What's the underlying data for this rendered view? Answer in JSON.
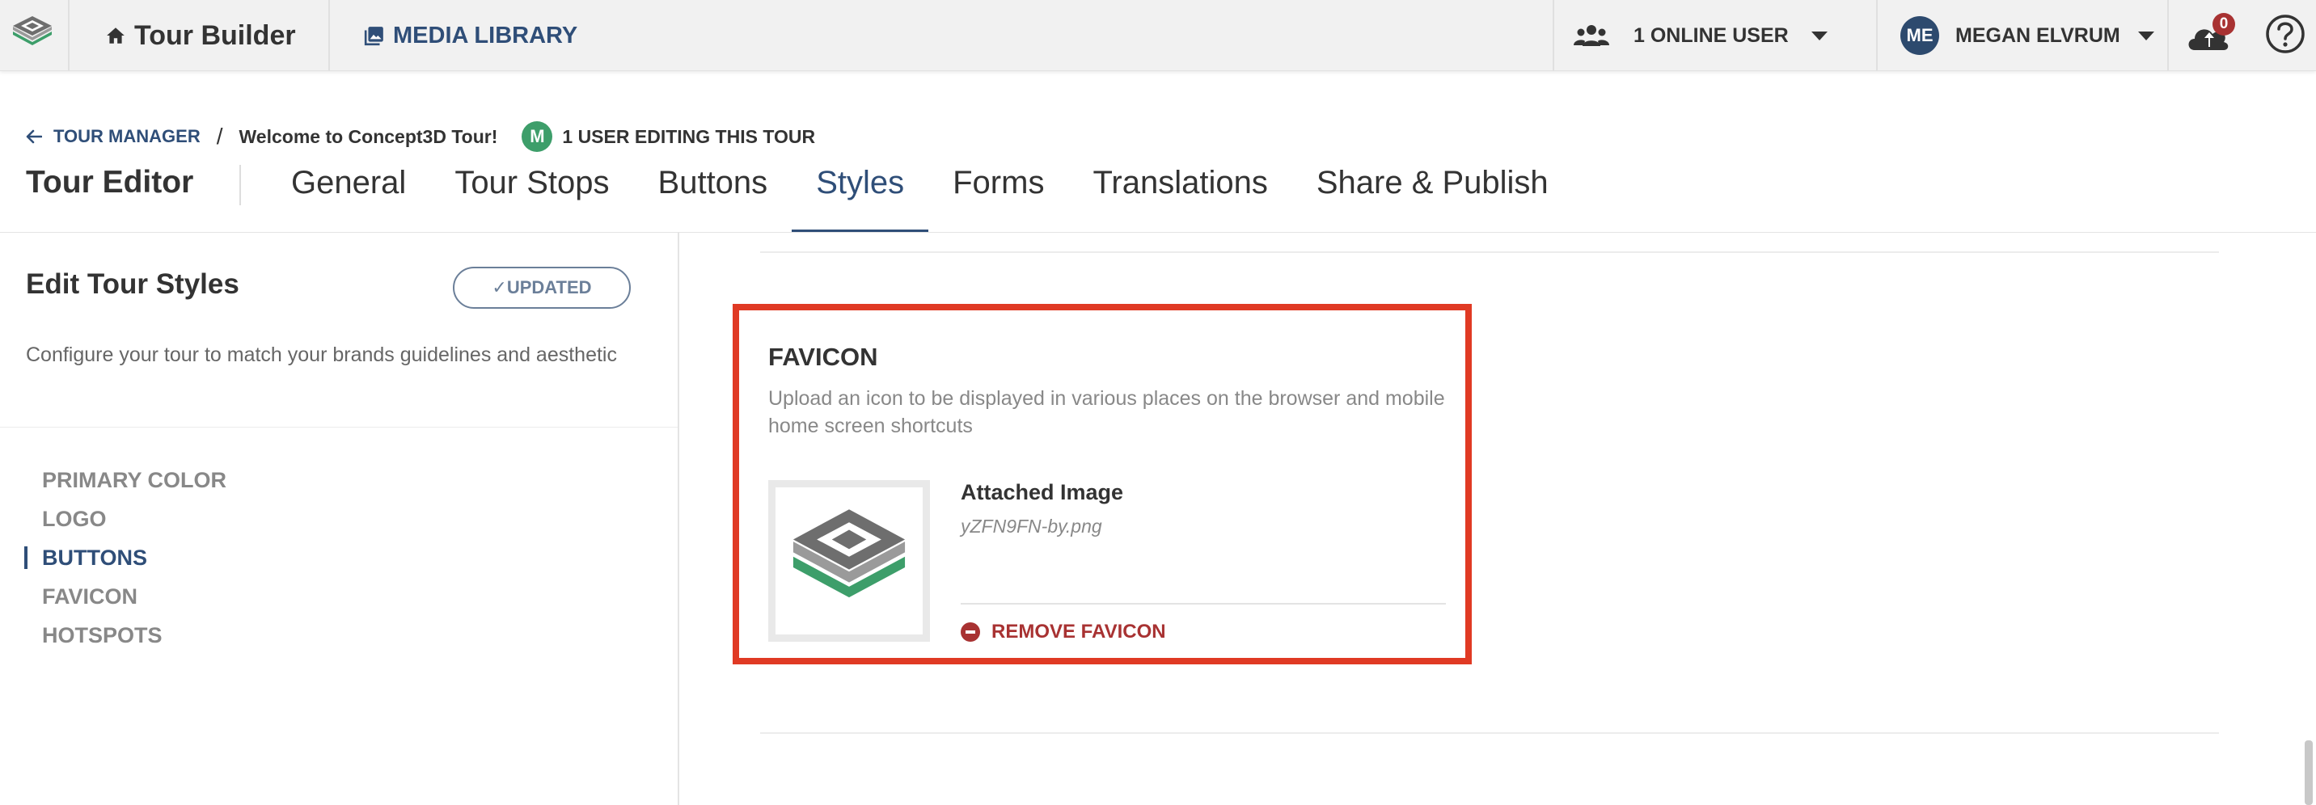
{
  "topbar": {
    "app_title": "Tour Builder",
    "media_library": "MEDIA LIBRARY",
    "online_users": "1 ONLINE USER",
    "user_initials": "ME",
    "user_name": "MEGAN ELVRUM",
    "upload_count": "0"
  },
  "breadcrumb": {
    "back_label": "TOUR MANAGER",
    "separator": "/",
    "tour_name": "Welcome to Concept3D Tour!",
    "editor_initial": "M",
    "editing_status": "1 USER EDITING THIS TOUR"
  },
  "editor": {
    "title": "Tour Editor",
    "tabs": [
      "General",
      "Tour Stops",
      "Buttons",
      "Styles",
      "Forms",
      "Translations",
      "Share & Publish"
    ],
    "active_tab": "Styles"
  },
  "sidebar": {
    "title": "Edit Tour Styles",
    "status_badge": "✓UPDATED",
    "description": "Configure your tour to match your brands guidelines and aesthetic",
    "nav": [
      "PRIMARY COLOR",
      "LOGO",
      "BUTTONS",
      "FAVICON",
      "HOTSPOTS"
    ],
    "active_nav": "BUTTONS"
  },
  "favicon": {
    "title": "FAVICON",
    "description": "Upload an icon to be displayed in various places on the browser and mobile home screen shortcuts",
    "attached_label": "Attached Image",
    "file_name": "yZFN9FN-by.png",
    "remove_label": "REMOVE FAVICON"
  },
  "colors": {
    "brand_navy": "#2f4e78",
    "highlight": "#e03a24",
    "danger": "#a83232",
    "editor_green": "#3d9e6a"
  }
}
